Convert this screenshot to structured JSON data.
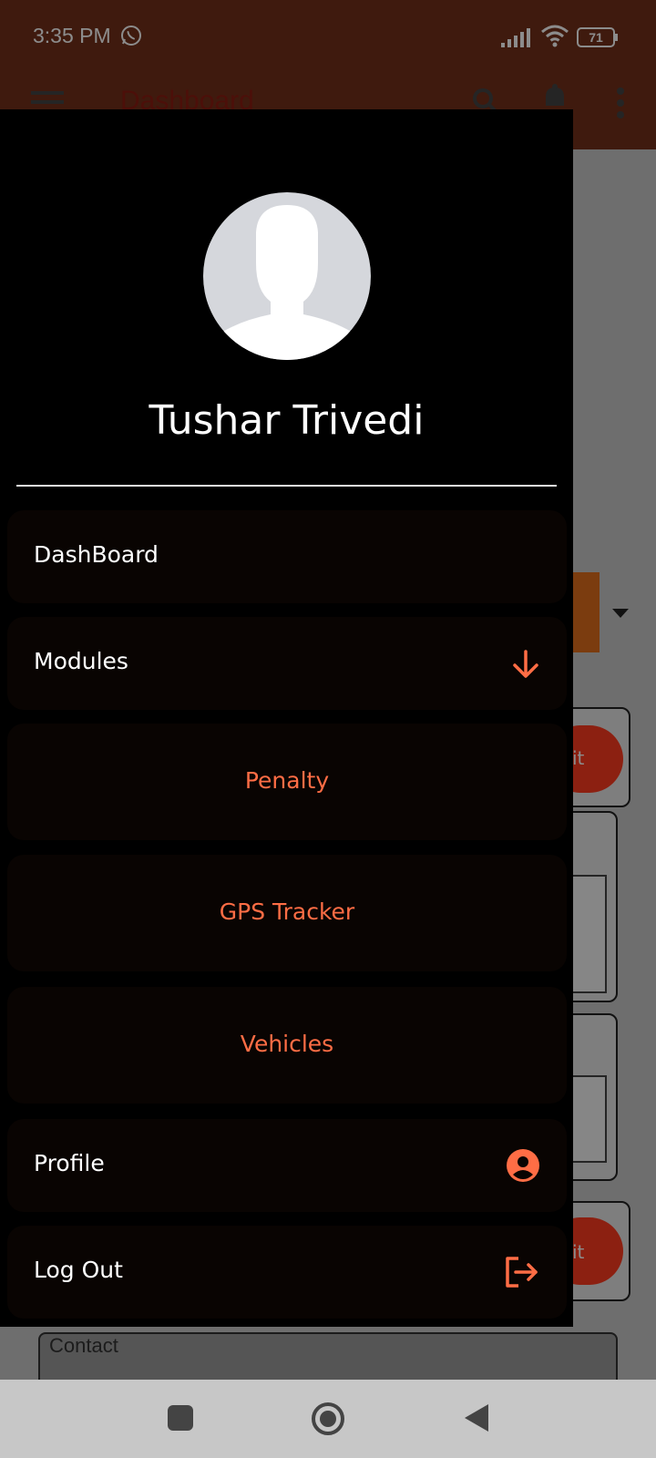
{
  "status_bar": {
    "time": "3:35 PM",
    "battery": "71"
  },
  "app_toolbar": {
    "title": "Dashboard"
  },
  "background": {
    "contact_label": "Contact",
    "button_fragment": "it"
  },
  "drawer": {
    "user_name": "Tushar Trivedi",
    "items": [
      {
        "label": "DashBoard"
      },
      {
        "label": "Modules",
        "icon": "arrow-down-icon"
      },
      {
        "label": "Penalty"
      },
      {
        "label": "GPS Tracker"
      },
      {
        "label": "Vehicles"
      },
      {
        "label": "Profile",
        "icon": "account-circle-icon"
      },
      {
        "label": "Log Out",
        "icon": "logout-icon"
      }
    ]
  },
  "colors": {
    "accent": "#ff6d45",
    "toolbar": "#74311a",
    "drawer_bg": "#000000",
    "item_bg": "#090402"
  }
}
